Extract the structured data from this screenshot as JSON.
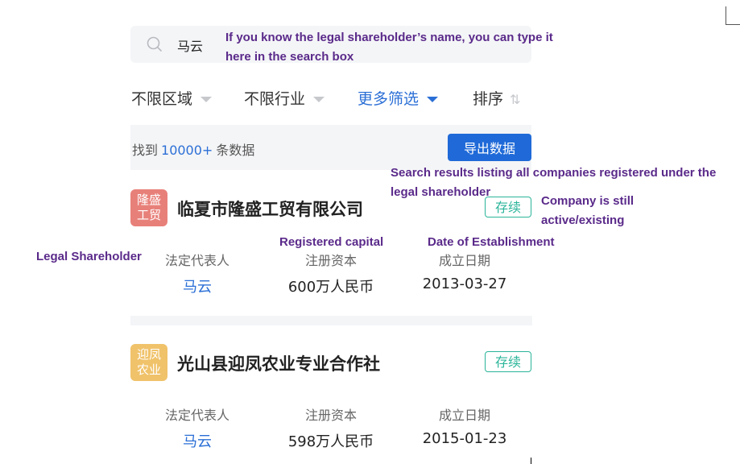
{
  "search": {
    "value": "马云"
  },
  "filters": [
    {
      "label": "不限区域",
      "active": false
    },
    {
      "label": "不限行业",
      "active": false
    },
    {
      "label": "更多筛选",
      "active": true
    },
    {
      "label": "排序",
      "active": false
    }
  ],
  "summary": {
    "prefix": "找到",
    "count": "10000+",
    "suffix": "条数据",
    "export_label": "导出数据"
  },
  "columns": {
    "legal_rep": "法定代表人",
    "capital": "注册资本",
    "established": "成立日期"
  },
  "companies": [
    {
      "logo_line1": "隆盛",
      "logo_line2": "工贸",
      "logo_color": "#e8807a",
      "name": "临夏市隆盛工贸有限公司",
      "status": "存续",
      "legal_rep": "马云",
      "capital": "600万人民币",
      "established": "2013-03-27"
    },
    {
      "logo_line1": "迎凤",
      "logo_line2": "农业",
      "logo_color": "#f0c26a",
      "name": "光山县迎凤农业专业合作社",
      "status": "存续",
      "legal_rep": "马云",
      "capital": "598万人民币",
      "established": "2015-01-23"
    }
  ],
  "annotations": {
    "search_box": "If you know the legal shareholder’s name, you can type it here in the search box",
    "results_line1": "Search results listing all companies registered under the",
    "results_line2": "legal shareholder",
    "status_line1": "Company is still",
    "status_line2": "active/existing",
    "legal_shareholder": "Legal Shareholder",
    "registered_capital": "Registered capital",
    "date_of_establishment": "Date of Establishment"
  },
  "colors": {
    "accent": "#1f6ad8",
    "status": "#2bb59a",
    "annotation": "#5a2a8a"
  }
}
